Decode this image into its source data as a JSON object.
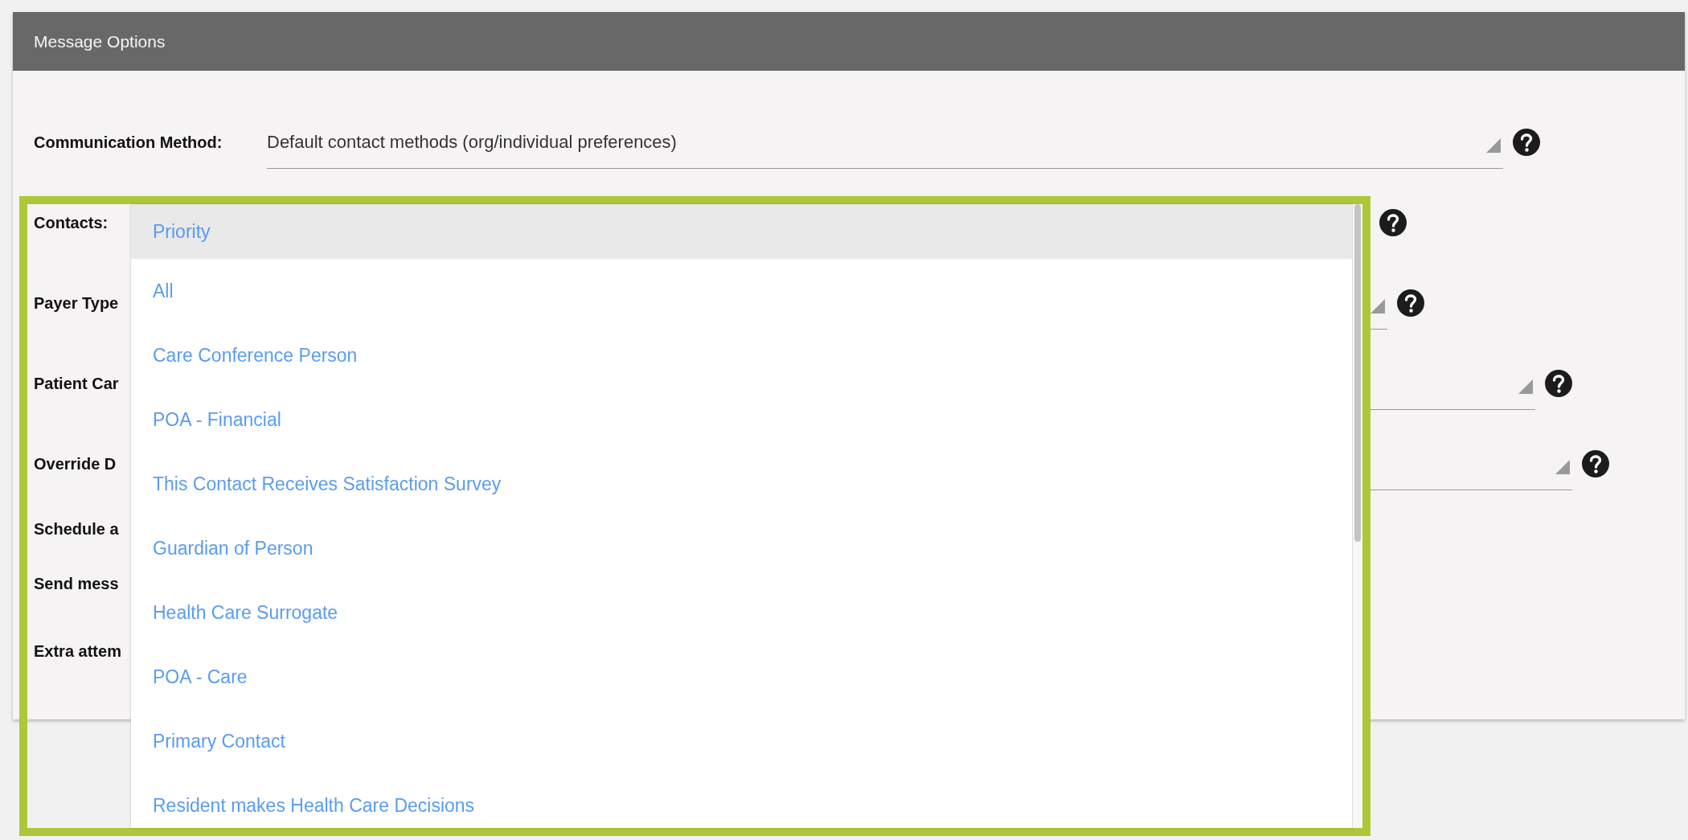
{
  "panel": {
    "title": "Message Options"
  },
  "rows": [
    {
      "kind": "select",
      "label": "Communication Method:",
      "value": "Default contact methods (org/individual preferences)"
    },
    {
      "kind": "multi",
      "label": "Contacts:"
    },
    {
      "kind": "select",
      "label": "Payer Type"
    },
    {
      "kind": "select",
      "label": "Patient Car"
    },
    {
      "kind": "select",
      "label": "Override D"
    },
    {
      "kind": "label",
      "label": "Schedule a"
    },
    {
      "kind": "label",
      "label": "Send mess"
    },
    {
      "kind": "label",
      "label": "Extra attem"
    }
  ],
  "dropdown": {
    "items": [
      {
        "label": "Priority",
        "highlighted": true
      },
      {
        "label": "All",
        "highlighted": false
      },
      {
        "label": "Care Conference Person",
        "highlighted": false
      },
      {
        "label": "POA - Financial",
        "highlighted": false
      },
      {
        "label": "This Contact Receives Satisfaction Survey",
        "highlighted": false
      },
      {
        "label": "Guardian of Person",
        "highlighted": false
      },
      {
        "label": "Health Care Surrogate",
        "highlighted": false
      },
      {
        "label": "POA - Care",
        "highlighted": false
      },
      {
        "label": "Primary Contact",
        "highlighted": false
      },
      {
        "label": "Resident makes Health Care Decisions",
        "highlighted": false
      }
    ]
  }
}
